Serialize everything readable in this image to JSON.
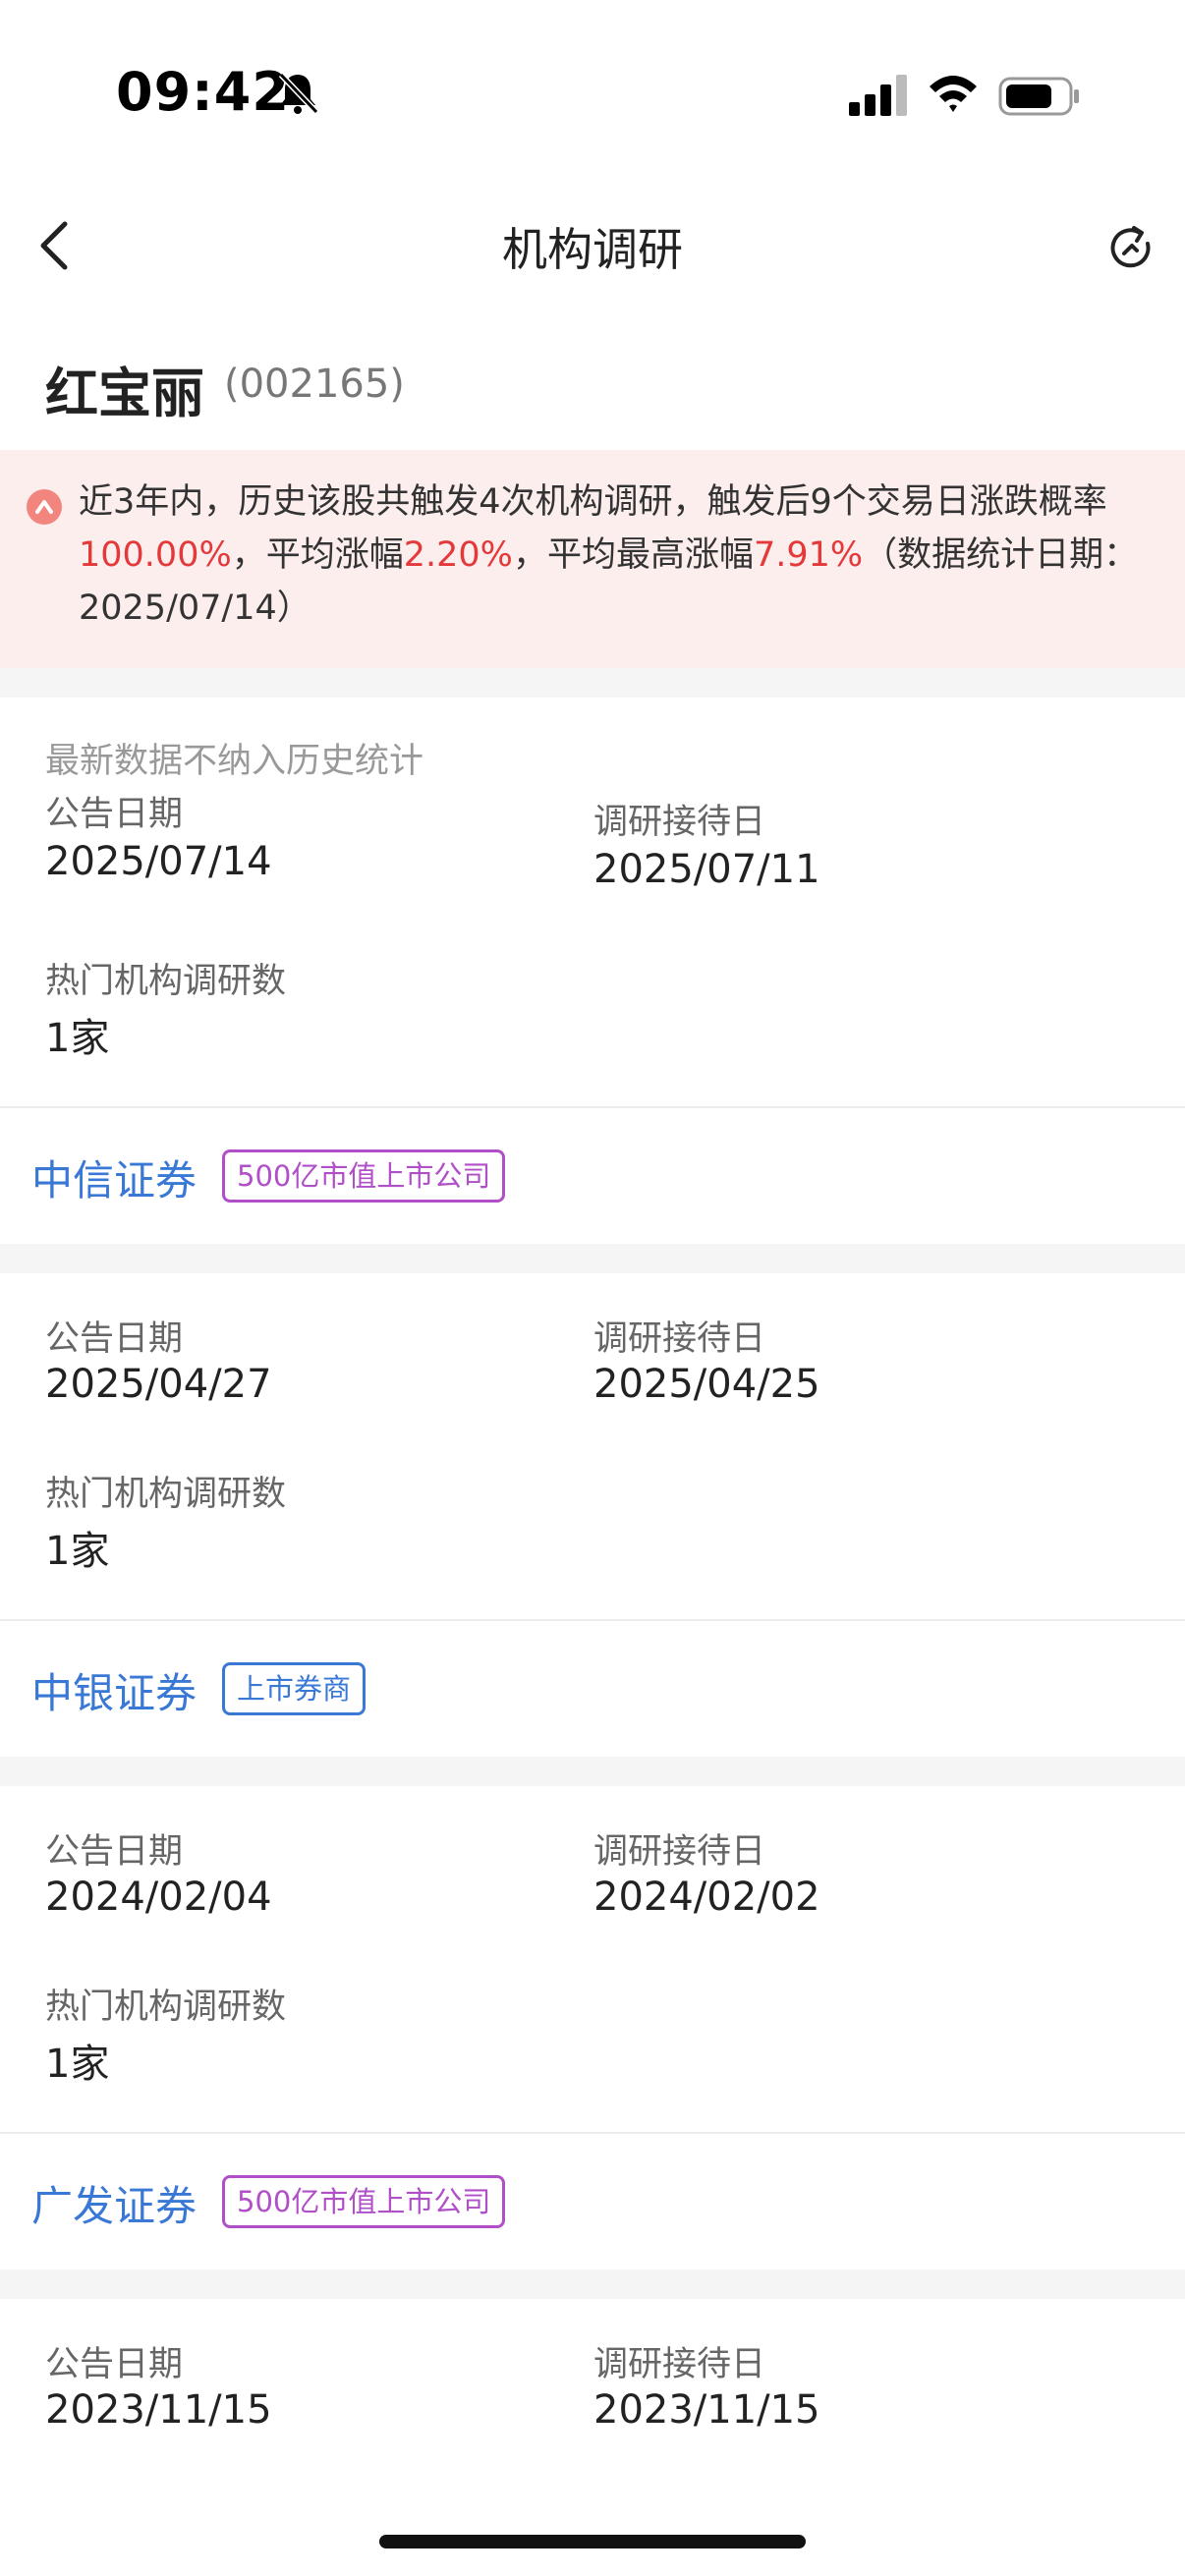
{
  "status_bar": {
    "time": "09:42"
  },
  "nav": {
    "title": "机构调研"
  },
  "stock": {
    "name": "红宝丽",
    "code": "(002165)"
  },
  "summary": {
    "part1": "近3年内，历史该股共触发4次机构调研，触发后9个交易日涨跌概率",
    "prob": "100.00%",
    "part2": "，平均涨幅",
    "avg_gain": "2.20%",
    "part3": "，平均最高涨幅",
    "max_gain": "7.91%",
    "part4": "（数据统计日期：2025/07/14）"
  },
  "labels": {
    "announce_date": "公告日期",
    "visit_date": "调研接待日",
    "hot_count": "热门机构调研数"
  },
  "latest_note": "最新数据不纳入历史统计",
  "records": [
    {
      "announce": "2025/07/14",
      "visit": "2025/07/11",
      "count": "1家",
      "institution": "中信证券",
      "tag": "500亿市值上市公司"
    },
    {
      "announce": "2025/04/27",
      "visit": "2025/04/25",
      "count": "1家",
      "institution": "中银证券",
      "tag": "上市券商"
    },
    {
      "announce": "2024/02/04",
      "visit": "2024/02/02",
      "count": "1家",
      "institution": "广发证券",
      "tag": "500亿市值上市公司"
    },
    {
      "announce": "2023/11/15",
      "visit": "2023/11/15"
    }
  ],
  "colors": {
    "accent_blue": "#3a78d6",
    "highlight_red": "#e3393a",
    "tag_purple": "#b04fc8",
    "banner_bg": "#fdeeee"
  },
  "icons": [
    "bell-slash-icon",
    "signal-icon",
    "wifi-icon",
    "battery-icon",
    "back-arrow-icon",
    "refresh-icon",
    "up-arrow-circle-icon"
  ]
}
